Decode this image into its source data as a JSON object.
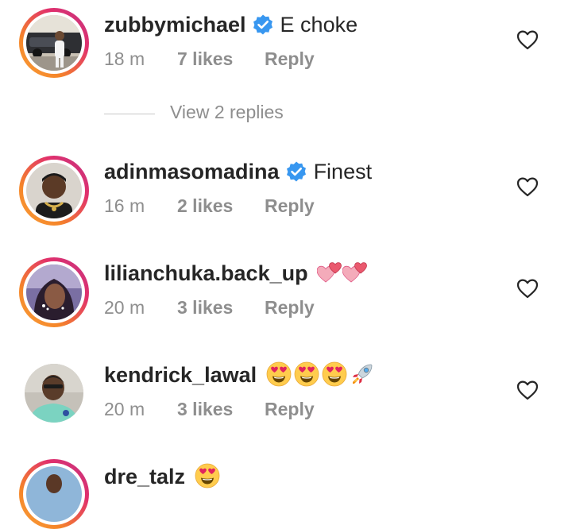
{
  "comments": [
    {
      "username": "zubbymichael",
      "verified": true,
      "text": "E choke",
      "time": "18 m",
      "likes": "7 likes",
      "reply_label": "Reply",
      "has_story_ring": true
    },
    {
      "username": "adinmasomadina",
      "verified": true,
      "text": "Finest",
      "time": "16 m",
      "likes": "2 likes",
      "reply_label": "Reply",
      "has_story_ring": true
    },
    {
      "username": "lilianchuka.back_up",
      "verified": false,
      "text": "",
      "emojis": [
        "two-hearts",
        "two-hearts"
      ],
      "time": "20 m",
      "likes": "3 likes",
      "reply_label": "Reply",
      "has_story_ring": true
    },
    {
      "username": "kendrick_lawal",
      "verified": false,
      "text": "",
      "emojis": [
        "heart-eyes",
        "heart-eyes",
        "heart-eyes",
        "rocket"
      ],
      "time": "20 m",
      "likes": "3 likes",
      "reply_label": "Reply",
      "has_story_ring": false
    },
    {
      "username": "dre_talz",
      "verified": false,
      "text": "",
      "emojis": [
        "heart-eyes"
      ],
      "has_story_ring": true
    }
  ],
  "view_replies": {
    "label": "View 2 replies"
  },
  "colors": {
    "text_primary": "#262626",
    "text_secondary": "#8e8e8e",
    "verified_blue": "#3897f0",
    "story_ring_start": "#f9a03a",
    "story_ring_end": "#c13584"
  }
}
